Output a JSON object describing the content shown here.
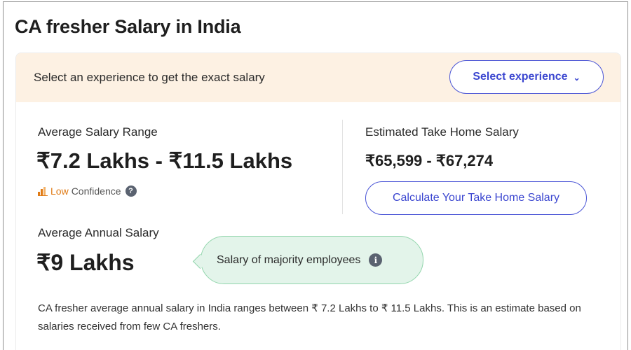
{
  "page": {
    "title": "CA fresher Salary in India"
  },
  "banner": {
    "text": "Select an experience to get the exact salary",
    "select_label": "Select experience",
    "select_icon": "chevron-down-icon"
  },
  "salary_range": {
    "label": "Average Salary Range",
    "value": "₹7.2 Lakhs - ₹11.5 Lakhs",
    "confidence_level": "Low",
    "confidence_text": "Confidence",
    "confidence_icon": "bar-chart-icon",
    "help_icon": "help-icon"
  },
  "take_home": {
    "label": "Estimated Take Home Salary",
    "value": "₹65,599 - ₹67,274",
    "button_label": "Calculate Your Take Home Salary"
  },
  "annual": {
    "label": "Average Annual Salary",
    "value": "₹9 Lakhs",
    "bubble_text": "Salary of majority employees",
    "bubble_icon": "info-icon"
  },
  "description": "CA fresher average annual salary in India ranges between ₹ 7.2 Lakhs to ₹ 11.5 Lakhs. This is an estimate based on salaries received from few CA freshers.",
  "colors": {
    "accent": "#3b46d0",
    "banner_bg": "#fdf1e3",
    "bubble_bg": "#e3f4ea",
    "confidence_low": "#e07b16"
  }
}
